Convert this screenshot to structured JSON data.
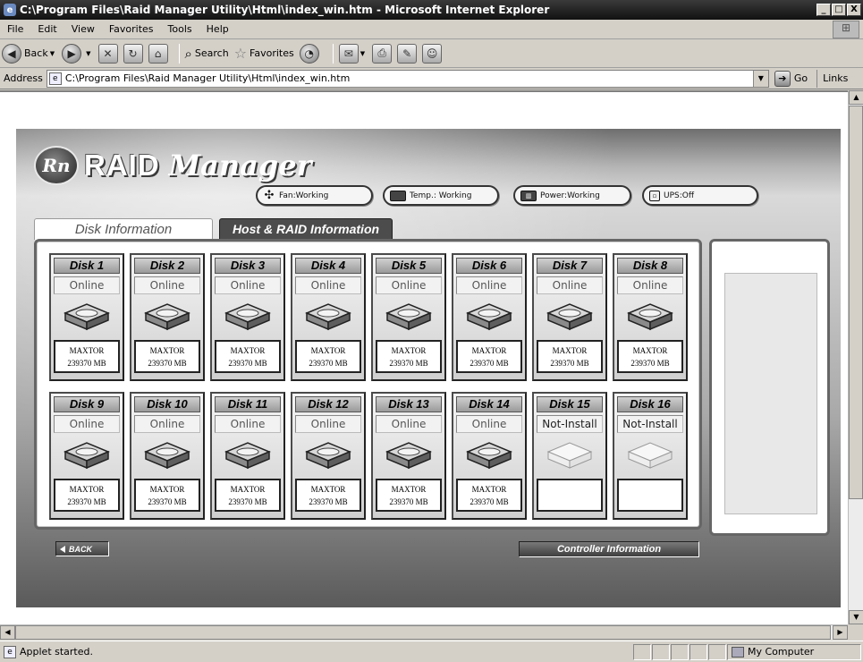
{
  "window": {
    "title": "C:\\Program Files\\Raid Manager Utility\\Html\\index_win.htm - Microsoft Internet Explorer",
    "controls": [
      "_",
      "□",
      "X"
    ]
  },
  "menu": [
    "File",
    "Edit",
    "View",
    "Favorites",
    "Tools",
    "Help"
  ],
  "toolbar": {
    "back_label": "Back",
    "search_label": "Search",
    "favorites_label": "Favorites"
  },
  "address": {
    "label": "Address",
    "value": "C:\\Program Files\\Raid Manager Utility\\Html\\index_win.htm",
    "go_label": "Go",
    "links_label": "Links"
  },
  "status": {
    "text": "Applet started.",
    "zone": "My Computer"
  },
  "applet": {
    "logo_badge": "Rn",
    "logo_main": "RAID",
    "logo_script": "Manager",
    "indicators": [
      {
        "label": "Fan:Working",
        "icon": "fan-icon"
      },
      {
        "label": "Temp.: Working",
        "icon": "thermometer-icon"
      },
      {
        "label": "Power:Working",
        "icon": "power-supply-icon"
      },
      {
        "label": "UPS:Off",
        "icon": "ups-icon"
      }
    ],
    "tabs": {
      "disk_info": "Disk Information",
      "host_raid": "Host & RAID Information"
    },
    "disks": [
      {
        "name": "Disk 1",
        "status": "Online",
        "model": "MAXTOR",
        "size": "239370 MB",
        "installed": true
      },
      {
        "name": "Disk 2",
        "status": "Online",
        "model": "MAXTOR",
        "size": "239370 MB",
        "installed": true
      },
      {
        "name": "Disk 3",
        "status": "Online",
        "model": "MAXTOR",
        "size": "239370 MB",
        "installed": true
      },
      {
        "name": "Disk 4",
        "status": "Online",
        "model": "MAXTOR",
        "size": "239370 MB",
        "installed": true
      },
      {
        "name": "Disk 5",
        "status": "Online",
        "model": "MAXTOR",
        "size": "239370 MB",
        "installed": true
      },
      {
        "name": "Disk 6",
        "status": "Online",
        "model": "MAXTOR",
        "size": "239370 MB",
        "installed": true
      },
      {
        "name": "Disk 7",
        "status": "Online",
        "model": "MAXTOR",
        "size": "239370 MB",
        "installed": true
      },
      {
        "name": "Disk 8",
        "status": "Online",
        "model": "MAXTOR",
        "size": "239370 MB",
        "installed": true
      },
      {
        "name": "Disk 9",
        "status": "Online",
        "model": "MAXTOR",
        "size": "239370 MB",
        "installed": true
      },
      {
        "name": "Disk 10",
        "status": "Online",
        "model": "MAXTOR",
        "size": "239370 MB",
        "installed": true
      },
      {
        "name": "Disk 11",
        "status": "Online",
        "model": "MAXTOR",
        "size": "239370 MB",
        "installed": true
      },
      {
        "name": "Disk 12",
        "status": "Online",
        "model": "MAXTOR",
        "size": "239370 MB",
        "installed": true
      },
      {
        "name": "Disk 13",
        "status": "Online",
        "model": "MAXTOR",
        "size": "239370 MB",
        "installed": true
      },
      {
        "name": "Disk 14",
        "status": "Online",
        "model": "MAXTOR",
        "size": "239370 MB",
        "installed": true
      },
      {
        "name": "Disk 15",
        "status": "Not-Install",
        "model": "",
        "size": "",
        "installed": false
      },
      {
        "name": "Disk 16",
        "status": "Not-Install",
        "model": "",
        "size": "",
        "installed": false
      }
    ],
    "back_label": "BACK",
    "controller_label": "Controller Information"
  }
}
